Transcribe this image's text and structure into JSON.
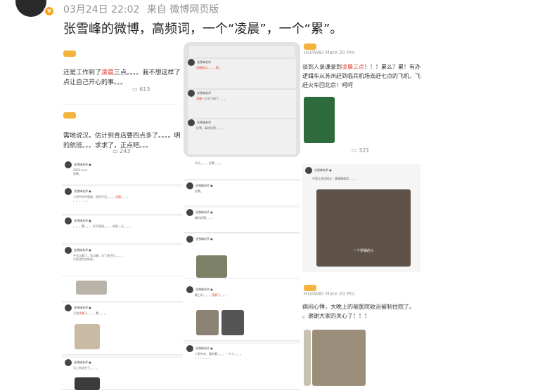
{
  "header": {
    "date": "03月24日 22:02",
    "source": "来自 微博网页版",
    "title": "张雪峰的微博，高频词，一个“凌晨”，一个“累”。"
  },
  "col1": {
    "post1_line1_pre": "还是工作到了",
    "post1_line1_red": "凌晨",
    "post1_line1_post": "三点。。。。我不想这样了。",
    "post1_line2": "点让自己开心的事。。。",
    "post1_comments": "613",
    "post2_line1": "需地说汉。估计到青店要四点多了。。。。明天",
    "post2_line2": "的航班。。。求求了，正点吧。。。",
    "post2_comments": "243"
  },
  "col3": {
    "device1": "HUAWEI Mate 20 Pro",
    "post1_pre": "谈到人录课录到",
    "post1_red": "凌晨三点",
    "post1_post": "！！！累么？累！有办",
    "post1_line2": "逻辑车从苏州赶到临兵机场去赶七点的飞机，飞",
    "post1_line3": "赶火车回北京！呵呵",
    "post1_comments": "321",
    "device2": "HUAWEI Mate 20 Pro",
    "post2_line1": "病闷心悸，大晚上的被医院收治留制住院了。",
    "post2_line2": "。谢谢大家的关心了！！！",
    "video_caption": "一个罗辑的人"
  }
}
